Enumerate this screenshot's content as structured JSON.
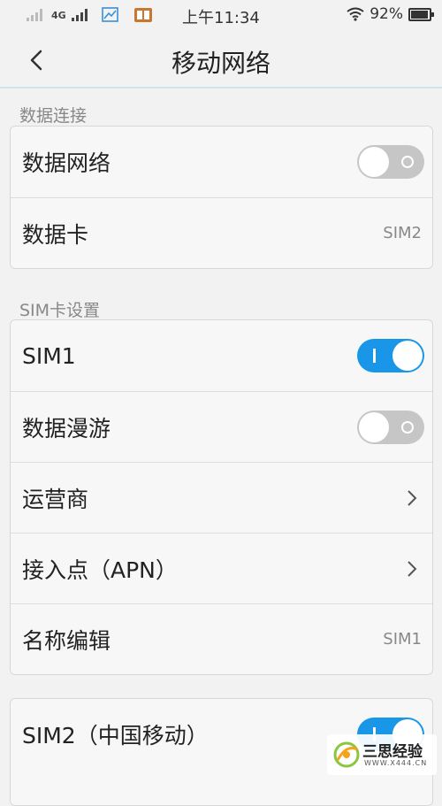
{
  "status_bar": {
    "network": "4G",
    "time": "上午11:34",
    "battery": "92%"
  },
  "header": {
    "title": "移动网络"
  },
  "sections": {
    "data": {
      "label": "数据连接",
      "data_network": {
        "label": "数据网络",
        "enabled": false
      },
      "data_card": {
        "label": "数据卡",
        "value": "SIM2"
      }
    },
    "sim": {
      "label": "SIM卡设置",
      "sim1": {
        "label": "SIM1",
        "enabled": true
      },
      "roaming": {
        "label": "数据漫游",
        "enabled": false
      },
      "carrier": {
        "label": "运营商"
      },
      "apn": {
        "label": "接入点（APN）"
      },
      "name_edit": {
        "label": "名称编辑",
        "value": "SIM1"
      }
    },
    "sim2": {
      "sim2": {
        "label": "SIM2（中国移动）",
        "enabled": true
      }
    }
  },
  "watermark": {
    "name": "三思经验",
    "url": "WWW.X444.CN"
  },
  "colors": {
    "accent": "#1a96e8",
    "toggle_off": "#c6c6c6",
    "background": "#f2f2f2"
  }
}
